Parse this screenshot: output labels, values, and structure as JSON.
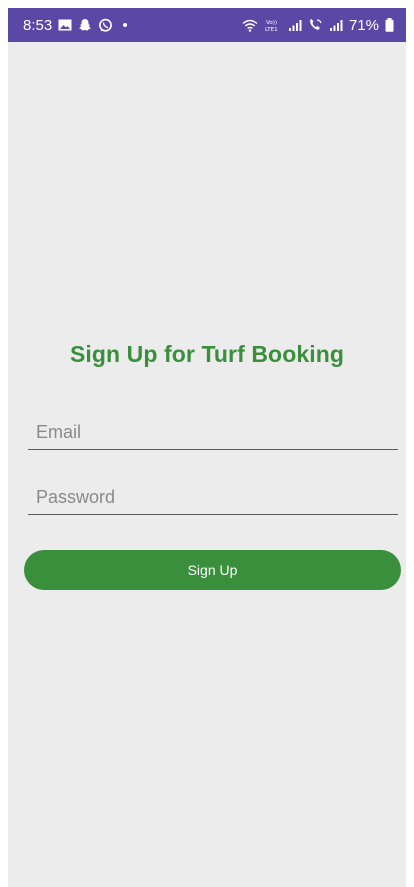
{
  "status_bar": {
    "time": "8:53",
    "battery": "71%",
    "background": "#5a48a6",
    "left_icons": [
      "gallery-icon",
      "snapchat-icon",
      "whatsapp-icon",
      "notification-dot"
    ],
    "right_icons": [
      "wifi-icon",
      "volte-icon",
      "signal-icon",
      "wifi-calling-icon",
      "signal-icon",
      "battery-icon"
    ],
    "volte_text": "Vo)) LTE1"
  },
  "page": {
    "background": "#ececec",
    "title": "Sign Up for Turf Booking",
    "accent_color": "#3a8f3c"
  },
  "form": {
    "email_placeholder": "Email",
    "email_value": "",
    "password_placeholder": "Password",
    "password_value": "",
    "submit_label": "Sign Up"
  }
}
